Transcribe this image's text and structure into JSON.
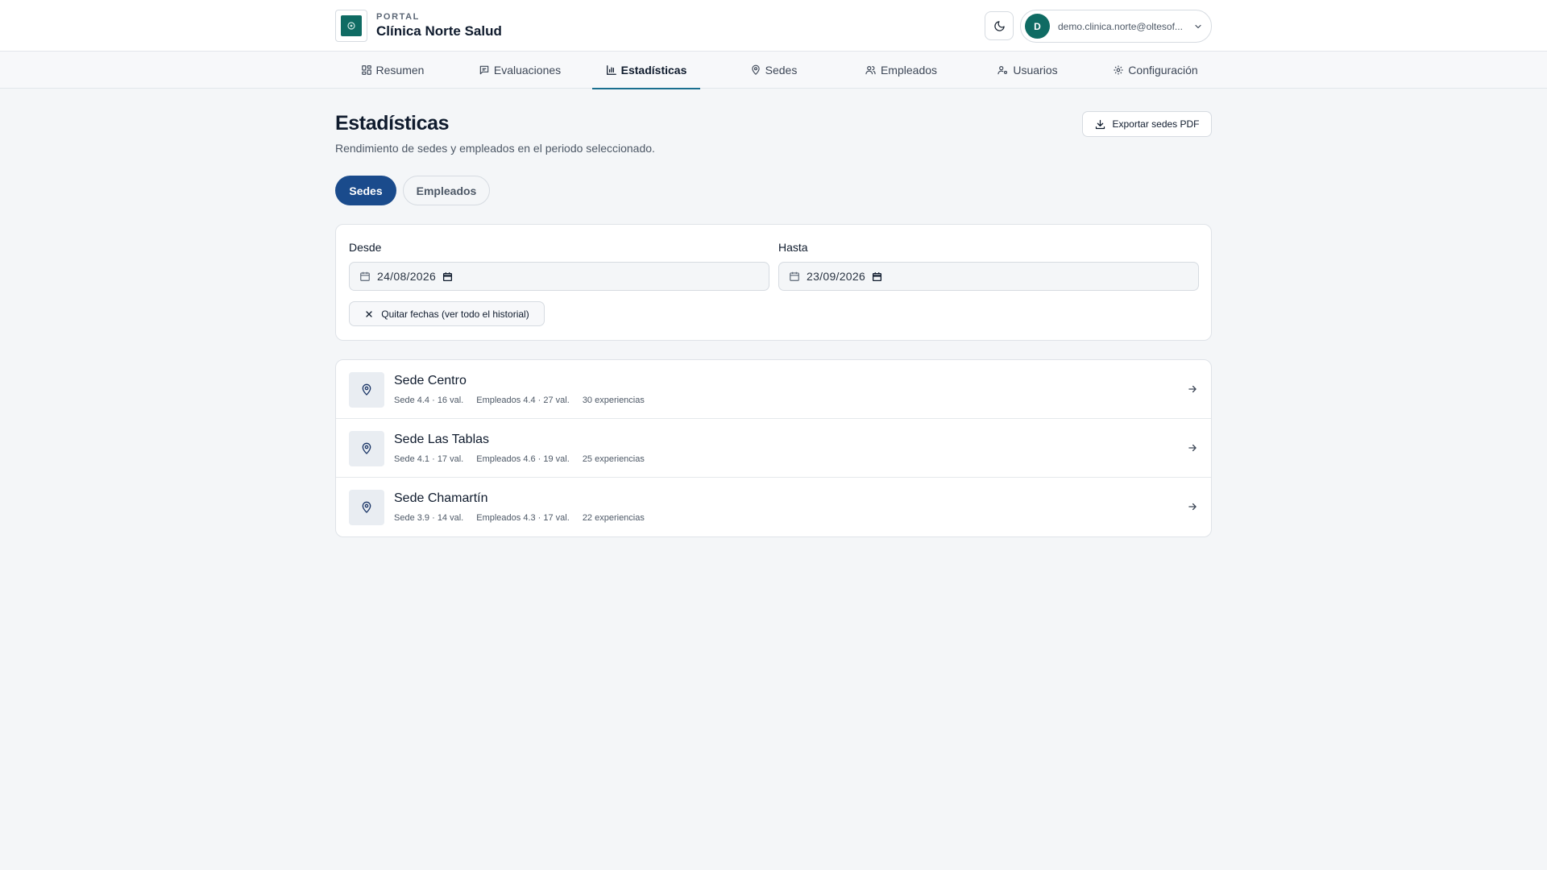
{
  "header": {
    "kicker": "PORTAL",
    "org_name": "Clínica Norte Salud",
    "user_initial": "D",
    "user_email": "demo.clinica.norte@oltesof..."
  },
  "nav": {
    "items": [
      {
        "label": "Resumen",
        "icon": "grid-icon"
      },
      {
        "label": "Evaluaciones",
        "icon": "message-icon"
      },
      {
        "label": "Estadísticas",
        "icon": "bar-chart-icon",
        "active": true
      },
      {
        "label": "Sedes",
        "icon": "map-pin-icon"
      },
      {
        "label": "Empleados",
        "icon": "users-icon"
      },
      {
        "label": "Usuarios",
        "icon": "user-cog-icon"
      },
      {
        "label": "Configuración",
        "icon": "gear-icon"
      }
    ]
  },
  "page": {
    "title": "Estadísticas",
    "subtitle": "Rendimiento de sedes y empleados en el periodo seleccionado.",
    "export_label": "Exportar sedes PDF"
  },
  "tabs": {
    "active": "Sedes",
    "other": "Empleados"
  },
  "filters": {
    "from_label": "Desde",
    "from_value": "24/08/2026",
    "to_label": "Hasta",
    "to_value": "23/09/2026",
    "clear_label": "Quitar fechas (ver todo el historial)"
  },
  "sedes": [
    {
      "name": "Sede Centro",
      "sede": "Sede 4.4 · 16 val.",
      "empleados": "Empleados 4.4 · 27 val.",
      "experiencias": "30 experiencias"
    },
    {
      "name": "Sede Las Tablas",
      "sede": "Sede 4.1 · 17 val.",
      "empleados": "Empleados 4.6 · 19 val.",
      "experiencias": "25 experiencias"
    },
    {
      "name": "Sede Chamartín",
      "sede": "Sede 3.9 · 14 val.",
      "empleados": "Empleados 4.3 · 17 val.",
      "experiencias": "22 experiencias"
    }
  ],
  "colors": {
    "primary": "#1a4b8c",
    "teal": "#0f6b63",
    "background": "#f4f6f8"
  }
}
